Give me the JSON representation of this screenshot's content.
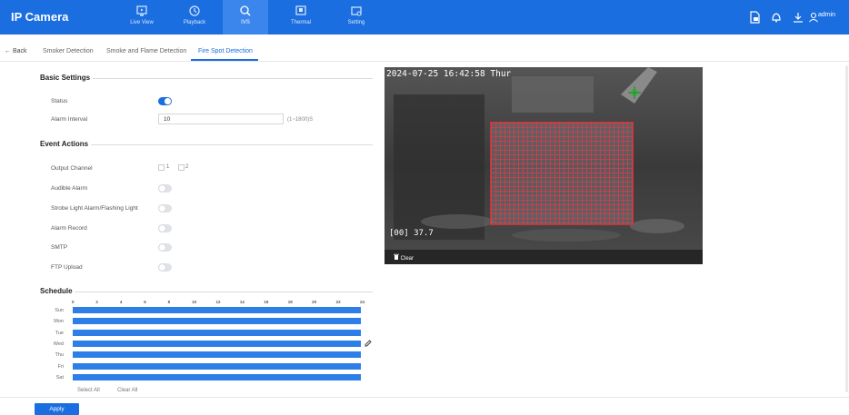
{
  "app": {
    "title": "IP Camera",
    "user": "admin"
  },
  "nav": [
    {
      "label": "Live View",
      "icon": "live-view-icon"
    },
    {
      "label": "Playback",
      "icon": "playback-icon"
    },
    {
      "label": "IVS",
      "icon": "ivs-icon"
    },
    {
      "label": "Thermal",
      "icon": "thermal-icon"
    },
    {
      "label": "Setting",
      "icon": "setting-icon"
    }
  ],
  "tabs": {
    "back": "Back",
    "items": [
      "Smoker Detection",
      "Smoke and Flame Detection",
      "Fire Spot Detection"
    ],
    "active": "Fire Spot Detection"
  },
  "basic": {
    "title": "Basic Settings",
    "status_label": "Status",
    "status_on": true,
    "interval_label": "Alarm Interval",
    "interval_value": "10",
    "interval_range": "(1~1800)S"
  },
  "actions": {
    "title": "Event Actions",
    "output_label": "Output Channel",
    "channels": [
      "1",
      "2"
    ],
    "rows": [
      {
        "label": "Audible Alarm",
        "on": false
      },
      {
        "label": "Strobe Light Alarm/Flashing Light",
        "on": false
      },
      {
        "label": "Alarm Record",
        "on": false
      },
      {
        "label": "SMTP",
        "on": false
      },
      {
        "label": "FTP Upload",
        "on": false
      }
    ]
  },
  "schedule": {
    "title": "Schedule",
    "hours": [
      "0",
      "2",
      "4",
      "6",
      "8",
      "10",
      "12",
      "14",
      "16",
      "18",
      "20",
      "22",
      "24"
    ],
    "days": [
      "Sun",
      "Mon",
      "Tue",
      "Wed",
      "Thu",
      "Fri",
      "Sat"
    ],
    "select_all": "Select All",
    "clear_all": "Clear All"
  },
  "video": {
    "timestamp": "2024-07-25 16:42:58 Thur",
    "temp_readout": "[00] 37.7",
    "clear_label": "Clear"
  },
  "apply_label": "Apply"
}
